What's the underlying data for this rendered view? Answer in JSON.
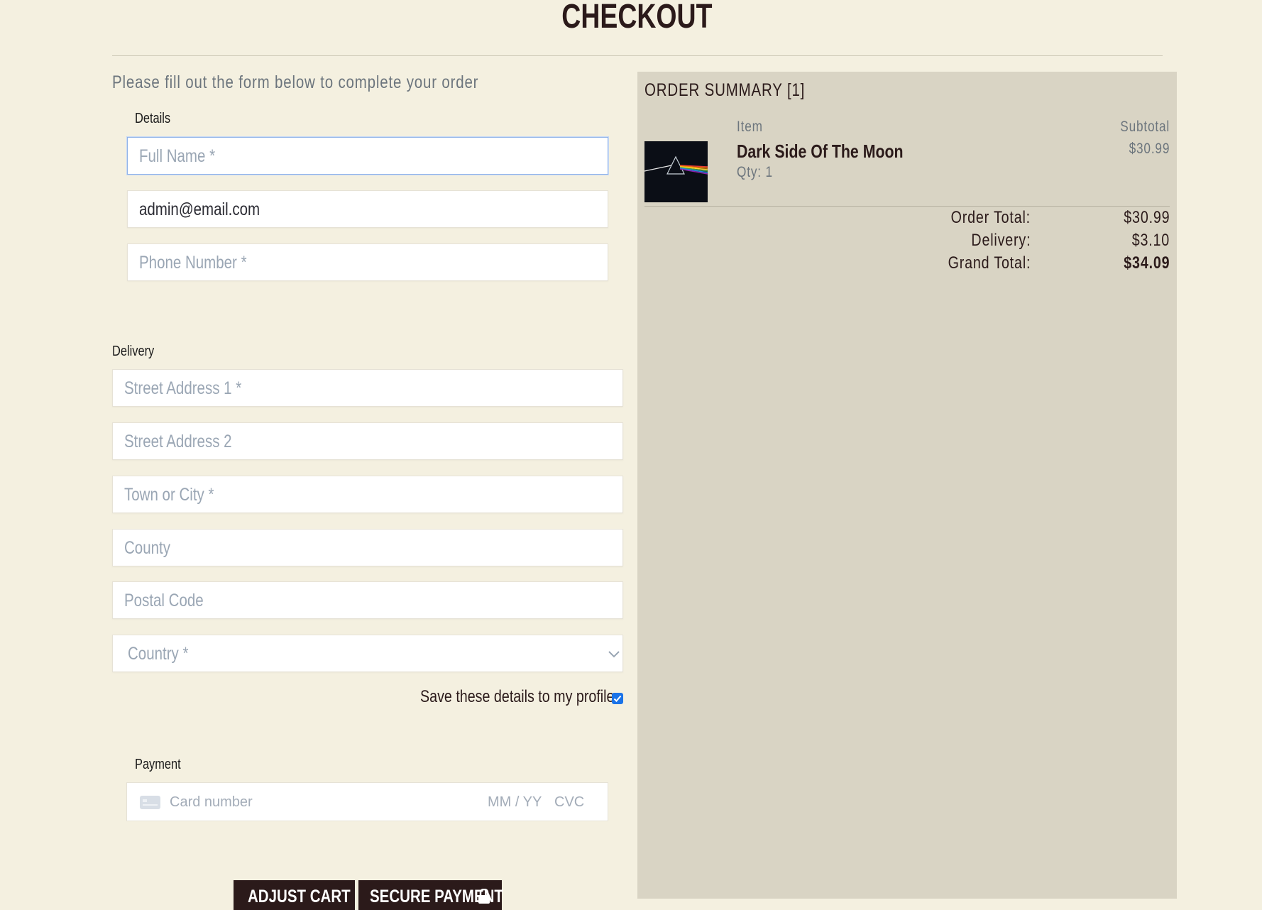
{
  "page": {
    "title": "CHECKOUT",
    "intro": "Please fill out the form below to complete your order"
  },
  "details": {
    "label": "Details",
    "full_name_placeholder": "Full Name *",
    "email_value": "admin@email.com",
    "phone_placeholder": "Phone Number *"
  },
  "delivery": {
    "label": "Delivery",
    "street1_placeholder": "Street Address 1 *",
    "street2_placeholder": "Street Address 2",
    "town_placeholder": "Town or City *",
    "county_placeholder": "County",
    "postal_placeholder": "Postal Code",
    "country_placeholder": "Country *",
    "save_label": "Save these details to my profile",
    "save_checked": true
  },
  "payment": {
    "label": "Payment",
    "card_placeholder": "Card number",
    "expiry_placeholder": "MM / YY",
    "cvc_placeholder": "CVC"
  },
  "buttons": {
    "adjust_cart": "ADJUST CART",
    "secure_payment": "SECURE PAYMENT"
  },
  "summary": {
    "title": "ORDER SUMMARY [1]",
    "col_item": "Item",
    "col_subtotal": "Subtotal",
    "items": [
      {
        "name": "Dark Side Of The Moon",
        "qty": "Qty: 1",
        "price": "$30.99"
      }
    ],
    "order_total_label": "Order Total:",
    "order_total": "$30.99",
    "delivery_label": "Delivery:",
    "delivery": "$3.10",
    "grand_total_label": "Grand Total:",
    "grand_total": "$34.09"
  },
  "colors": {
    "background": "#f4f0e0",
    "summary_panel": "#d9d4c4",
    "button": "#2b1a1a",
    "focus_border": "#8fb2e8"
  }
}
